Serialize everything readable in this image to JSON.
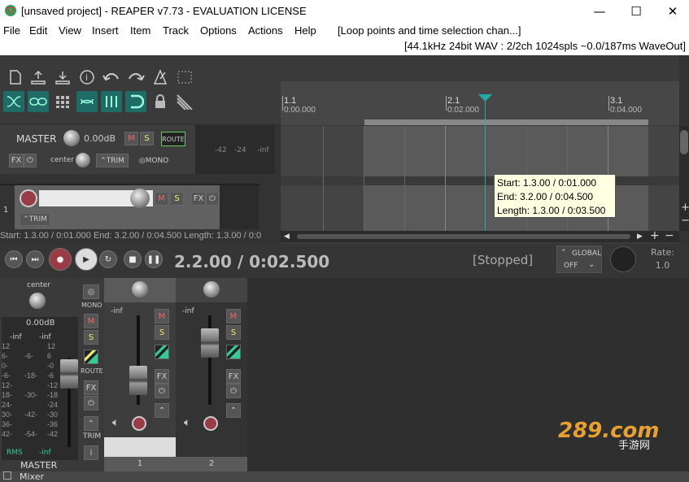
{
  "window": {
    "title": "[unsaved project] - REAPER v7.73 - EVALUATION LICENSE",
    "min": "—",
    "max": "☐",
    "close": "✕"
  },
  "menu": {
    "items": [
      "File",
      "Edit",
      "View",
      "Insert",
      "Item",
      "Track",
      "Options",
      "Actions",
      "Help"
    ],
    "hint": "[Loop points and time selection chan...]",
    "audio_info": "[44.1kHz 24bit WAV : 2/2ch 1024spls ~0.0/187ms WaveOut]"
  },
  "ruler": {
    "marks": [
      {
        "bar": "1.1",
        "time": "0:00.000"
      },
      {
        "bar": "2.1",
        "time": "0:02.000"
      },
      {
        "bar": "3.1",
        "time": "0:04.000"
      }
    ]
  },
  "tooltip": {
    "start": "Start: 1.3.00 / 0:01.000",
    "end": "End: 3.2.00 / 0:04.500",
    "length": "Length: 1.3.00 / 0:03.500"
  },
  "master_tcp": {
    "name": "MASTER",
    "volume": "0.00dB",
    "mute": "M",
    "solo": "S",
    "route": "ROUTE",
    "fx": "FX",
    "pan": "center",
    "trim": "TRIM",
    "mono": "MONO",
    "meter_labels": [
      "-42",
      "-24",
      "-inf"
    ]
  },
  "track1_tcp": {
    "number": "1",
    "mute": "M",
    "solo": "S",
    "fx": "FX",
    "trim": "TRIM"
  },
  "selection_status": "Start: 1.3.00 / 0:01.000 End: 3.2.00 / 0:04.500 Length: 1.3.00 / 0:0",
  "transport": {
    "time": "2.2.00 / 0:02.500",
    "state": "[Stopped]",
    "global": "GLOBAL",
    "global_state": "OFF",
    "rate_label": "Rate:",
    "rate_value": "1.0"
  },
  "mixer": {
    "master": {
      "pan": "center",
      "volume": "0.00dB",
      "peak_l": "-inf",
      "peak_r": "-inf",
      "mono": "MONO",
      "mute": "M",
      "solo": "S",
      "route": "ROUTE",
      "fx": "FX",
      "trim": "TRIM",
      "info": "i",
      "rms": "RMS",
      "rms_value": "-inf",
      "name": "MASTER",
      "scale_left": [
        "12",
        "6-",
        "0-",
        "-6-",
        "12-",
        "18-",
        "24-",
        "30-",
        "36-",
        "42-"
      ],
      "scale_mid": [
        "-6-",
        "-18-",
        "-30-",
        "-42-",
        "-54-"
      ],
      "scale_right": [
        "12",
        "6",
        "-0",
        "-6",
        "-12",
        "-18",
        "-24",
        "-30",
        "-36",
        "-42"
      ]
    },
    "strips": [
      {
        "number": "1",
        "peak": "-inf",
        "mute": "M",
        "solo": "S",
        "fx": "FX"
      },
      {
        "number": "2",
        "peak": "-inf",
        "mute": "M",
        "solo": "S",
        "fx": "FX"
      }
    ]
  },
  "bottom": {
    "tab": "Mixer"
  },
  "watermark": {
    "text": "289.com",
    "sub": "手游网"
  },
  "colors": {
    "accent": "#1f6c66",
    "record": "#9a3c45",
    "tooltip_bg": "#ffffe1",
    "cursor": "#22aaaa"
  }
}
